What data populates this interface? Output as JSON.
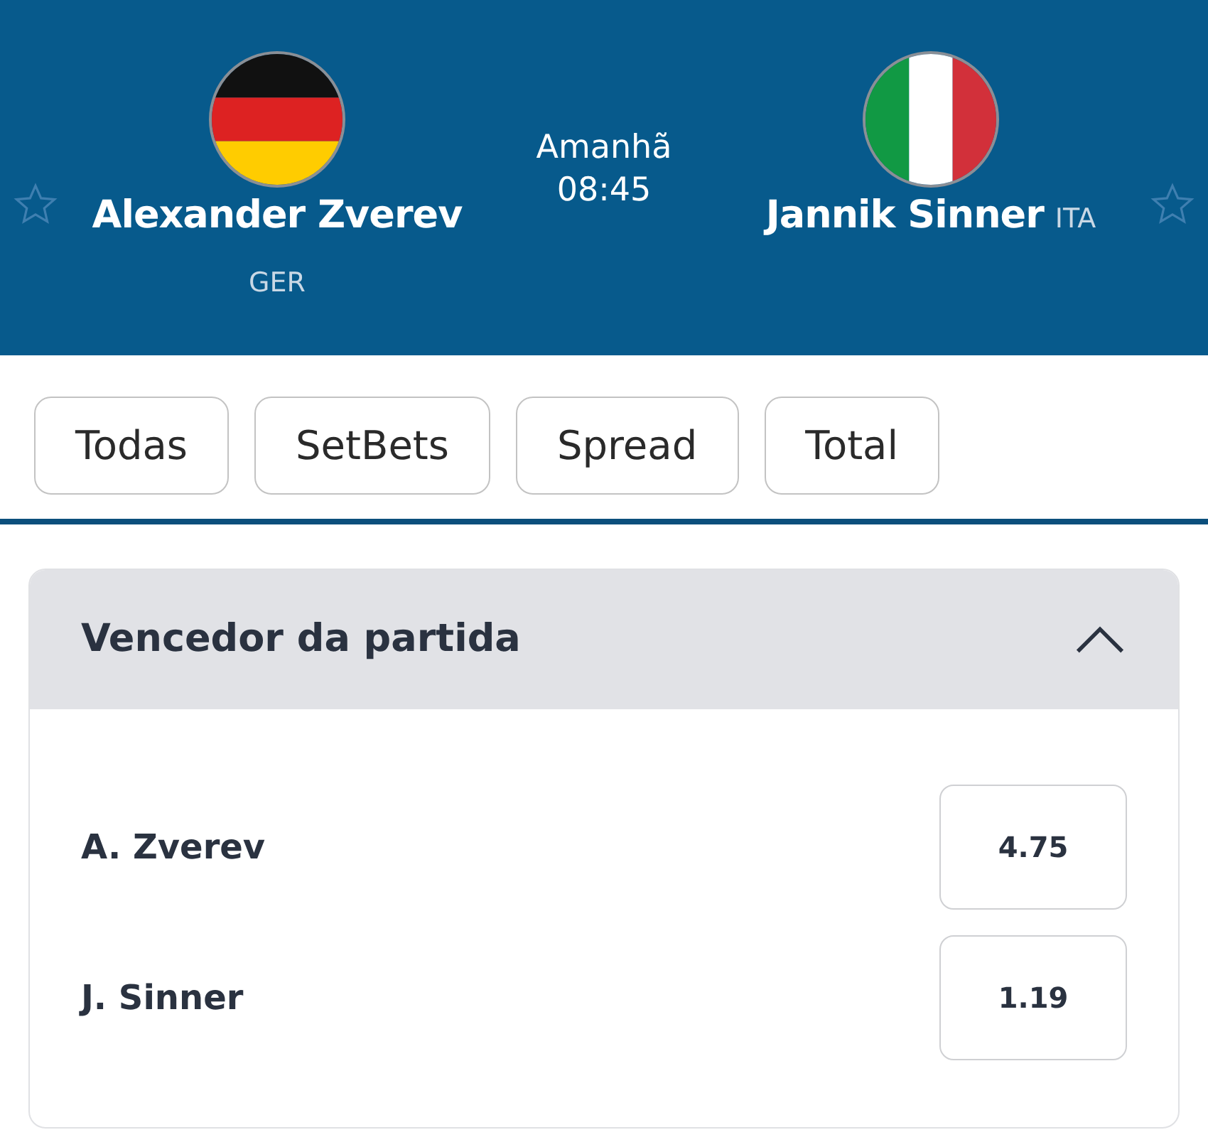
{
  "match": {
    "home": {
      "name": "Alexander Zverev",
      "country": "GER",
      "kind": "home",
      "favorite": false
    },
    "time": {
      "day": "Amanhã",
      "clock": "08:45"
    },
    "away": {
      "name": "Jannik Sinner",
      "country": "ITA",
      "kind": "away",
      "favorite": false
    }
  },
  "filters": [
    {
      "label": "Todas"
    },
    {
      "label": "SetBets"
    },
    {
      "label": "Spread"
    },
    {
      "label": "Total"
    }
  ],
  "market": {
    "title": "Vencedor da partida",
    "expanded": true,
    "selections": [
      {
        "name": "A. Zverev",
        "odds": "4.75"
      },
      {
        "name": "J. Sinner",
        "odds": "1.19"
      }
    ]
  }
}
